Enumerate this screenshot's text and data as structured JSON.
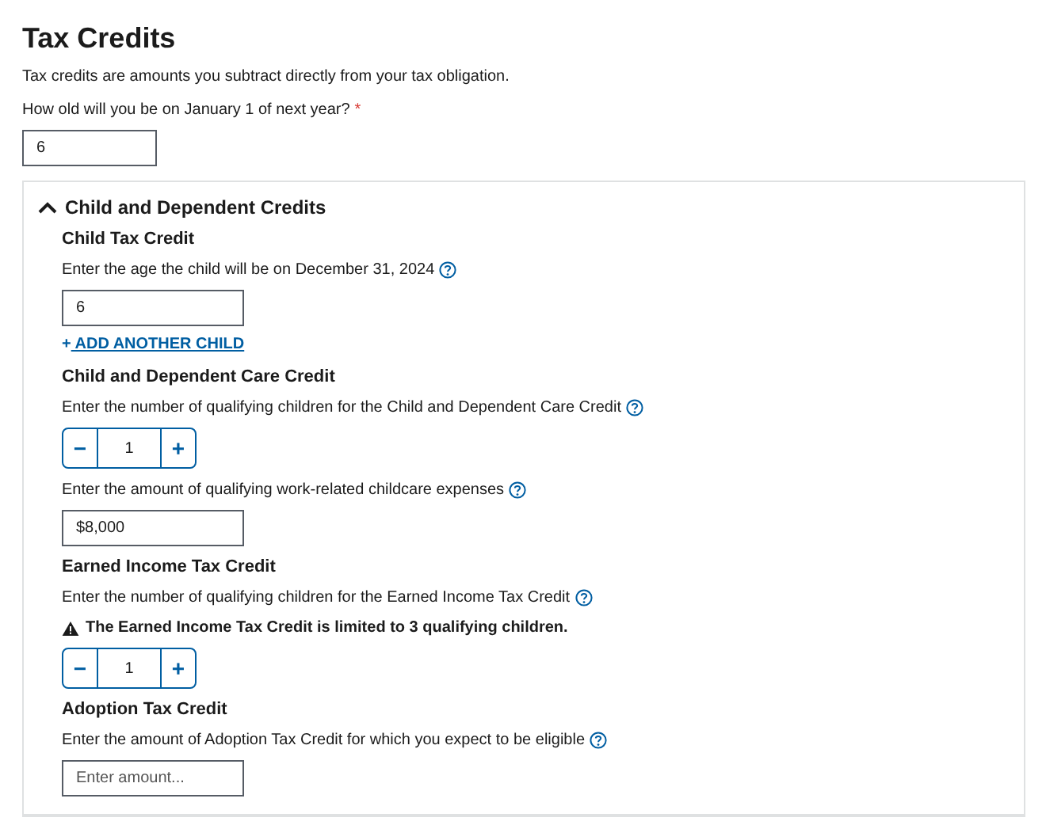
{
  "title": "Tax Credits",
  "intro": "Tax credits are amounts you subtract directly from your tax obligation.",
  "age_question": {
    "label": "How old will you be on January 1 of next year?",
    "required_mark": "*",
    "value": "6"
  },
  "panel": {
    "title": "Child and Dependent Credits",
    "expanded": true,
    "sections": [
      {
        "title": "Child Tax Credit",
        "items": [
          {
            "kind": "text",
            "label": "Enter the age the child will be on December 31, 2024",
            "help": true,
            "value": "6"
          },
          {
            "kind": "link",
            "icon": "+",
            "label": "ADD ANOTHER CHILD"
          }
        ]
      },
      {
        "title": "Child and Dependent Care Credit",
        "items": [
          {
            "kind": "stepper",
            "label": "Enter the number of qualifying children for the Child and Dependent Care Credit",
            "help": true,
            "minus": "−",
            "value": "1",
            "plus": "+"
          },
          {
            "kind": "text",
            "label": "Enter the amount of qualifying work-related childcare expenses",
            "help": true,
            "value": "$8,000"
          }
        ]
      },
      {
        "title": "Earned Income Tax Credit",
        "items": [
          {
            "kind": "stepper",
            "label": "Enter the number of qualifying children for the Earned Income Tax Credit",
            "help": true,
            "warning": "The Earned Income Tax Credit is limited to 3 qualifying children.",
            "minus": "−",
            "value": "1",
            "plus": "+"
          }
        ]
      },
      {
        "title": "Adoption Tax Credit",
        "items": [
          {
            "kind": "text",
            "label": "Enter the amount of Adoption Tax Credit for which you expect to be eligible",
            "help": true,
            "placeholder": "Enter amount..."
          }
        ]
      }
    ]
  }
}
